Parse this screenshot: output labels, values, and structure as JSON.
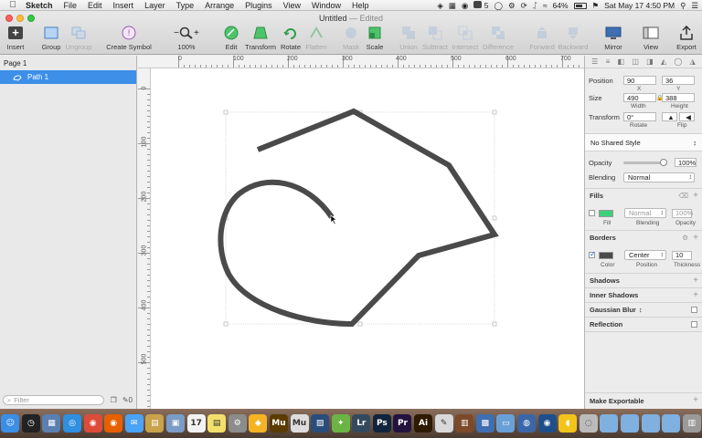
{
  "menubar": {
    "apple_icon": "apple-logo",
    "items": [
      "Sketch",
      "File",
      "Edit",
      "Insert",
      "Layer",
      "Type",
      "Arrange",
      "Plugins",
      "View",
      "Window",
      "Help"
    ],
    "status": {
      "notification_count": "5",
      "battery": "64%",
      "clock": "Sat May 17  4:50 PM"
    }
  },
  "window": {
    "title": "Untitled",
    "title_state": "— Edited"
  },
  "toolbar": {
    "insert": "Insert",
    "group": "Group",
    "ungroup": "Ungroup",
    "create_symbol": "Create Symbol",
    "zoom_minus": "−",
    "zoom_plus": "+",
    "zoom": "100%",
    "edit": "Edit",
    "transform": "Transform",
    "rotate": "Rotate",
    "flatten": "Flatten",
    "mask": "Mask",
    "scale": "Scale",
    "union": "Union",
    "subtract": "Subtract",
    "intersect": "Intersect",
    "difference": "Difference",
    "forward": "Forward",
    "backward": "Backward",
    "mirror": "Mirror",
    "view": "View",
    "export": "Export"
  },
  "layers": {
    "page": "Page 1",
    "items": [
      {
        "label": "Path 1",
        "icon": "path-icon",
        "selected": true
      }
    ],
    "filter_placeholder": "Filter",
    "filter_icon_glyph": "⌕",
    "panel_icons": [
      "❐",
      "✎0"
    ]
  },
  "rulers": {
    "top": [
      "0",
      "100",
      "200",
      "300",
      "400",
      "500",
      "600",
      "700"
    ],
    "left": [
      "0",
      "100",
      "200",
      "300",
      "400",
      "500"
    ]
  },
  "inspector": {
    "position": {
      "label": "Position",
      "x": "90",
      "y": "36",
      "x_label": "X",
      "y_label": "Y"
    },
    "size": {
      "label": "Size",
      "width": "490",
      "height": "388",
      "width_label": "Width",
      "height_label": "Height"
    },
    "transform": {
      "label": "Transform",
      "rotate": "0°",
      "rotate_label": "Rotate",
      "flip_label": "Flip"
    },
    "shared_style": "No Shared Style",
    "opacity": {
      "label": "Opacity",
      "value": "100%",
      "level": 1.0
    },
    "blending": {
      "label": "Blending",
      "value": "Normal"
    },
    "fills": {
      "title": "Fills",
      "enabled": false,
      "color": "#3dd17a",
      "blend": "Normal",
      "opacity": "100%",
      "fill_label": "Fill",
      "blending_label": "Blending",
      "opacity_label": "Opacity"
    },
    "borders": {
      "title": "Borders",
      "enabled": true,
      "color": "#4a4a4a",
      "position": "Center",
      "thickness": "10",
      "color_label": "Color",
      "position_label": "Position",
      "thickness_label": "Thickness"
    },
    "sections": [
      "Shadows",
      "Inner Shadows",
      "Gaussian Blur",
      "Reflection"
    ],
    "make_exportable": "Make Exportable"
  },
  "canvas": {
    "stroke_color": "#4a4a4a",
    "background": "#ffffff"
  },
  "dock": {
    "apps": [
      {
        "name": "finder",
        "color": "#3a8ee6",
        "glyph": "☺"
      },
      {
        "name": "dashboard",
        "color": "#222222",
        "glyph": "◷"
      },
      {
        "name": "mission-control",
        "color": "#5a7fb0",
        "glyph": "▦"
      },
      {
        "name": "safari",
        "color": "#2f8fe0",
        "glyph": "◎"
      },
      {
        "name": "chrome",
        "color": "#dd4b39",
        "glyph": "◉"
      },
      {
        "name": "firefox",
        "color": "#e66000",
        "glyph": "◉"
      },
      {
        "name": "messages",
        "color": "#4aa3f5",
        "glyph": "✉"
      },
      {
        "name": "notes",
        "color": "#c9a24a",
        "glyph": "▤"
      },
      {
        "name": "preview",
        "color": "#7a9cc6",
        "glyph": "▣"
      },
      {
        "name": "calendar",
        "color": "#f2f2f2",
        "glyph": "17"
      },
      {
        "name": "stickies",
        "color": "#f3e06b",
        "glyph": "▤"
      },
      {
        "name": "system-preferences",
        "color": "#8c8c8c",
        "glyph": "⚙"
      },
      {
        "name": "sketch",
        "color": "#f5b324",
        "glyph": "◆"
      },
      {
        "name": "muse",
        "color": "#5b3b00",
        "glyph": "Mu"
      },
      {
        "name": "muse-2",
        "color": "#dddddd",
        "glyph": "Mu"
      },
      {
        "name": "photo-app",
        "color": "#2b4d7a",
        "glyph": "▨"
      },
      {
        "name": "color-app",
        "color": "#6bb445",
        "glyph": "✦"
      },
      {
        "name": "lightroom",
        "color": "#334a5e",
        "glyph": "Lr"
      },
      {
        "name": "photoshop",
        "color": "#10243d",
        "glyph": "Ps"
      },
      {
        "name": "premiere",
        "color": "#23133f",
        "glyph": "Pr"
      },
      {
        "name": "illustrator",
        "color": "#2d1a00",
        "glyph": "Ai"
      },
      {
        "name": "pencil-app",
        "color": "#d9d9d9",
        "glyph": "✎"
      },
      {
        "name": "book-app",
        "color": "#7c4a2a",
        "glyph": "▥"
      },
      {
        "name": "stats-app",
        "color": "#3f6fb0",
        "glyph": "▩"
      },
      {
        "name": "folder-app",
        "color": "#6aa0d8",
        "glyph": "▭"
      },
      {
        "name": "network-app",
        "color": "#3a66a8",
        "glyph": "◍"
      },
      {
        "name": "globe-app",
        "color": "#1f4f8a",
        "glyph": "◉"
      },
      {
        "name": "cyberduck",
        "color": "#f2c41b",
        "glyph": "◖"
      },
      {
        "name": "utility-app",
        "color": "#bbbbbb",
        "glyph": "◌"
      },
      {
        "name": "folder-1",
        "color": "#7fb0e0",
        "glyph": ""
      },
      {
        "name": "folder-2",
        "color": "#7fb0e0",
        "glyph": ""
      },
      {
        "name": "folder-3",
        "color": "#7fb0e0",
        "glyph": ""
      },
      {
        "name": "folder-4",
        "color": "#7fb0e0",
        "glyph": ""
      },
      {
        "name": "trash",
        "color": "#9a9a9a",
        "glyph": "▥"
      }
    ]
  }
}
